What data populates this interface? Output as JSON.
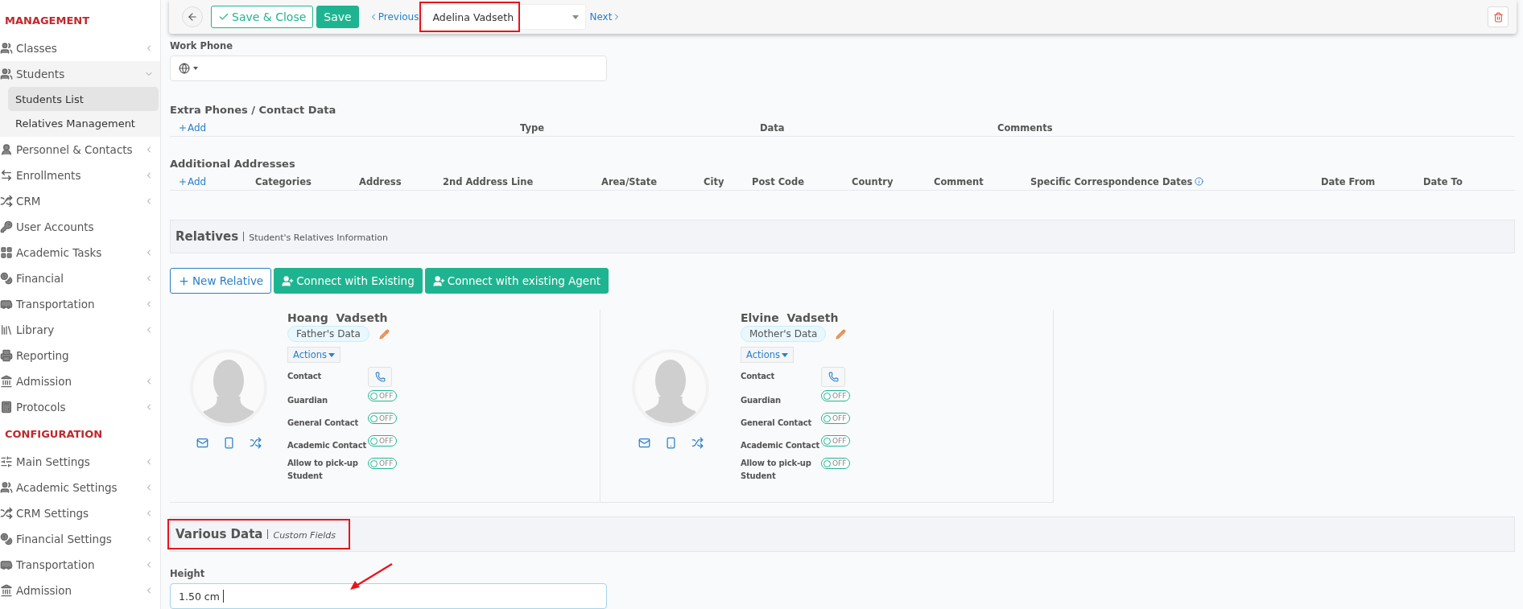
{
  "sidebar": {
    "sections": [
      {
        "title": "MANAGEMENT",
        "items": [
          {
            "label": "Classes",
            "has_submenu": true,
            "expanded": false,
            "selected": false
          },
          {
            "label": "Students",
            "has_submenu": true,
            "expanded": true,
            "selected": false,
            "children": [
              {
                "label": "Students List",
                "selected": true
              },
              {
                "label": "Relatives Management",
                "selected": false
              }
            ]
          },
          {
            "label": "Personnel & Contacts",
            "has_submenu": true,
            "expanded": false,
            "selected": false
          },
          {
            "label": "Enrollments",
            "has_submenu": true,
            "expanded": false,
            "selected": false
          },
          {
            "label": "CRM",
            "has_submenu": true,
            "expanded": false,
            "selected": false
          },
          {
            "label": "User Accounts",
            "has_submenu": false,
            "selected": false
          },
          {
            "label": "Academic Tasks",
            "has_submenu": true,
            "expanded": false,
            "selected": false
          },
          {
            "label": "Financial",
            "has_submenu": true,
            "expanded": false,
            "selected": false
          },
          {
            "label": "Transportation",
            "has_submenu": true,
            "expanded": false,
            "selected": false
          },
          {
            "label": "Library",
            "has_submenu": true,
            "expanded": false,
            "selected": false
          },
          {
            "label": "Reporting",
            "has_submenu": false,
            "selected": false
          },
          {
            "label": "Admission",
            "has_submenu": true,
            "expanded": false,
            "selected": false
          },
          {
            "label": "Protocols",
            "has_submenu": true,
            "expanded": false,
            "selected": false
          }
        ]
      },
      {
        "title": "CONFIGURATION",
        "items": [
          {
            "label": "Main Settings",
            "has_submenu": true,
            "expanded": false,
            "selected": false
          },
          {
            "label": "Academic Settings",
            "has_submenu": true,
            "expanded": false,
            "selected": false
          },
          {
            "label": "CRM Settings",
            "has_submenu": true,
            "expanded": false,
            "selected": false
          },
          {
            "label": "Financial Settings",
            "has_submenu": true,
            "expanded": false,
            "selected": false
          },
          {
            "label": "Transportation",
            "has_submenu": true,
            "expanded": false,
            "selected": false
          },
          {
            "label": "Admission",
            "has_submenu": true,
            "expanded": false,
            "selected": false
          }
        ]
      }
    ]
  },
  "toolbar": {
    "save_close": "Save & Close",
    "save": "Save",
    "previous": "Previous",
    "record": {
      "value": "Adelina Vadseth",
      "highlighted": true
    },
    "next": "Next"
  },
  "work_phone": {
    "label": "Work Phone"
  },
  "extra_phones": {
    "title": "Extra Phones / Contact Data",
    "add": "Add",
    "columns": [
      {
        "label": "Type",
        "info": false
      },
      {
        "label": "Data",
        "info": false
      },
      {
        "label": "Comments",
        "info": false
      }
    ]
  },
  "addresses": {
    "title": "Additional Addresses",
    "add": "Add",
    "columns": [
      {
        "label": "Categories",
        "info": false
      },
      {
        "label": "Address",
        "info": false
      },
      {
        "label": "2nd Address Line",
        "info": false
      },
      {
        "label": "Area/State",
        "info": false
      },
      {
        "label": "City",
        "info": false
      },
      {
        "label": "Post Code",
        "info": false
      },
      {
        "label": "Country",
        "info": false
      },
      {
        "label": "Comment",
        "info": false
      },
      {
        "label": "Specific Correspondence Dates",
        "info": true
      },
      {
        "label": "Date From",
        "info": false
      },
      {
        "label": "Date To",
        "info": false
      }
    ]
  },
  "relatives_section": {
    "title": "Relatives",
    "subtitle": "Student's Relatives Information",
    "highlighted": false
  },
  "relative_buttons": [
    {
      "label": "New Relative",
      "kind": "outline"
    },
    {
      "label": "Connect with Existing",
      "kind": "primary"
    },
    {
      "label": "Connect with existing Agent",
      "kind": "primary"
    }
  ],
  "relatives": [
    {
      "name": "Hoang  Vadseth",
      "tag": "Father's Data",
      "actions": "Actions",
      "rows": [
        {
          "label": "Contact",
          "kind": "call"
        },
        {
          "label": "Guardian",
          "kind": "toggle",
          "on": false,
          "state": "OFF"
        },
        {
          "label": "General Contact",
          "kind": "toggle",
          "on": false,
          "state": "OFF"
        },
        {
          "label": "Academic Contact",
          "kind": "toggle",
          "on": false,
          "state": "OFF"
        },
        {
          "label": "Allow to pick-up Student",
          "kind": "toggle",
          "on": false,
          "state": "OFF"
        }
      ]
    },
    {
      "name": "Elvine  Vadseth",
      "tag": "Mother's Data",
      "actions": "Actions",
      "rows": [
        {
          "label": "Contact",
          "kind": "call"
        },
        {
          "label": "Guardian",
          "kind": "toggle",
          "on": false,
          "state": "OFF"
        },
        {
          "label": "General Contact",
          "kind": "toggle",
          "on": false,
          "state": "OFF"
        },
        {
          "label": "Academic Contact",
          "kind": "toggle",
          "on": false,
          "state": "OFF"
        },
        {
          "label": "Allow to pick-up Student",
          "kind": "toggle",
          "on": false,
          "state": "OFF"
        }
      ]
    }
  ],
  "various_section": {
    "title": "Various Data",
    "subtitle": "Custom Fields",
    "highlighted": true
  },
  "height_field": {
    "label": "Height",
    "value": "1.50 cm",
    "arrow": true
  }
}
